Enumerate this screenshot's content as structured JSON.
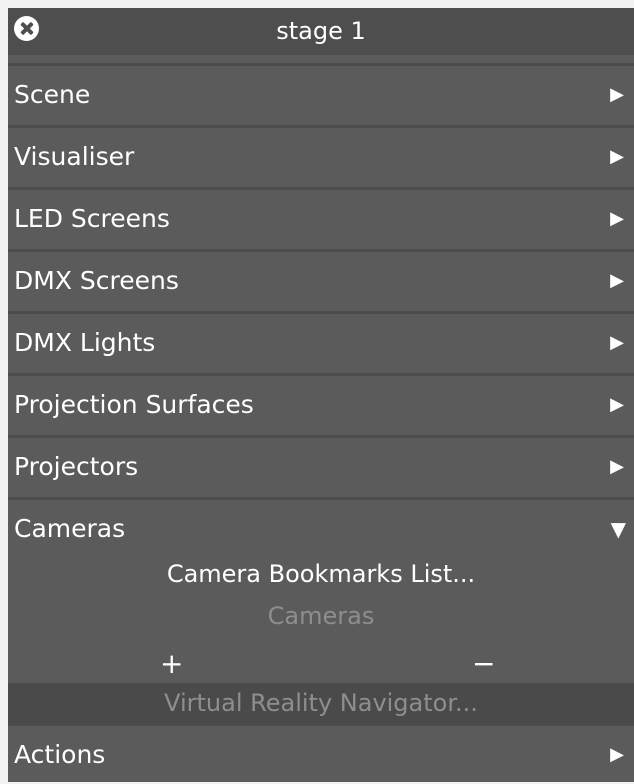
{
  "window": {
    "title": "stage 1"
  },
  "menu": [
    {
      "label": "Scene",
      "expanded": false
    },
    {
      "label": "Visualiser",
      "expanded": false
    },
    {
      "label": "LED Screens",
      "expanded": false
    },
    {
      "label": "DMX Screens",
      "expanded": false
    },
    {
      "label": "DMX Lights",
      "expanded": false
    },
    {
      "label": "Projection Surfaces",
      "expanded": false
    },
    {
      "label": "Projectors",
      "expanded": false
    },
    {
      "label": "Cameras",
      "expanded": true
    }
  ],
  "cameras": {
    "bookmarks_label": "Camera Bookmarks List...",
    "list_label": "Cameras",
    "add_label": "+",
    "remove_label": "−",
    "vr_label": "Virtual Reality Navigator..."
  },
  "actions": {
    "label": "Actions"
  },
  "icons": {
    "collapsed": "▶",
    "expanded": "▼"
  },
  "colors": {
    "panel": "#5b5b5b",
    "titlebar": "#4e4e4e",
    "muted_text": "#8e8e8e"
  }
}
